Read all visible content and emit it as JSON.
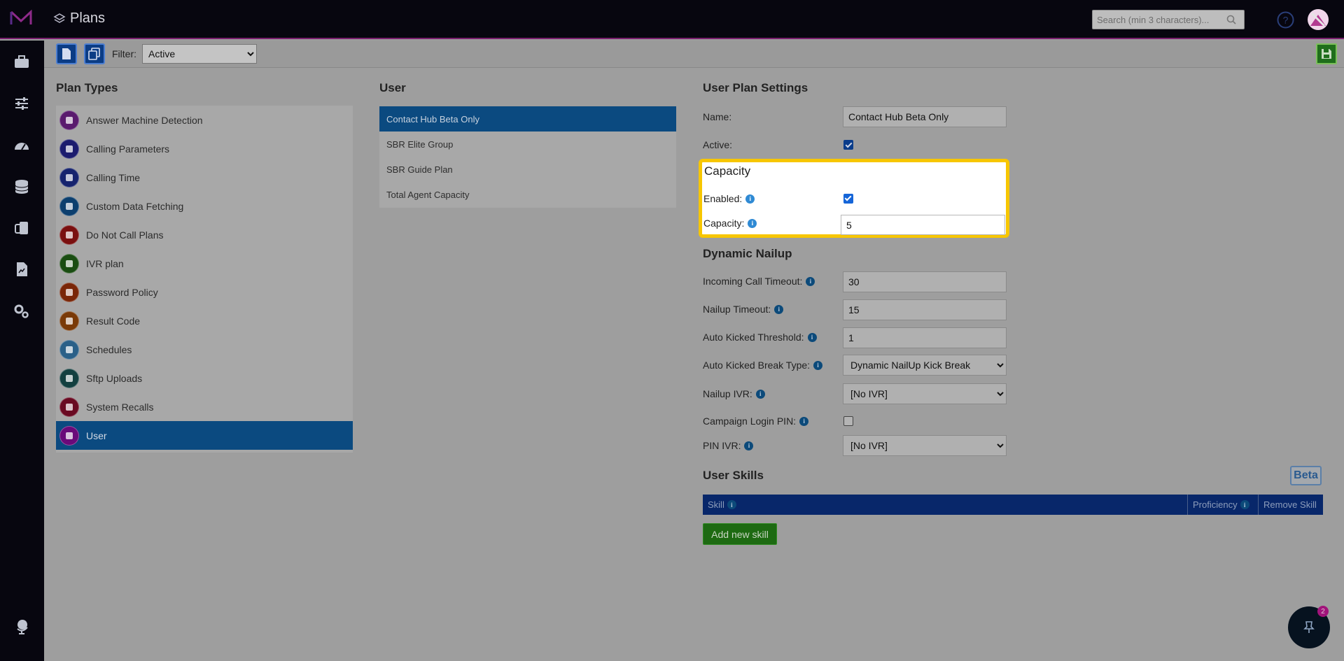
{
  "app": {
    "title": "Plans",
    "search_placeholder": "Search (min 3 characters)..."
  },
  "toolbar": {
    "filter_label": "Filter:",
    "filter_value": "Active",
    "filter_options": [
      "Active"
    ]
  },
  "plan_types": {
    "title": "Plan Types",
    "items": [
      {
        "label": "Answer Machine Detection",
        "color": "#5a1a6e"
      },
      {
        "label": "Calling Parameters",
        "color": "#1c1c6e"
      },
      {
        "label": "Calling Time",
        "color": "#16236e"
      },
      {
        "label": "Custom Data Fetching",
        "color": "#0c3f6e"
      },
      {
        "label": "Do Not Call Plans",
        "color": "#7a1010"
      },
      {
        "label": "IVR plan",
        "color": "#1a4d12"
      },
      {
        "label": "Password Policy",
        "color": "#7a2608"
      },
      {
        "label": "Result Code",
        "color": "#7a3a08"
      },
      {
        "label": "Schedules",
        "color": "#2a6088"
      },
      {
        "label": "Sftp Uploads",
        "color": "#134040"
      },
      {
        "label": "System Recalls",
        "color": "#6a0a22"
      },
      {
        "label": "User",
        "color": "#6a0a7a"
      }
    ],
    "active_index": 11
  },
  "user_list": {
    "title": "User",
    "items": [
      "Contact Hub Beta Only",
      "SBR Elite Group",
      "SBR Guide Plan",
      "Total Agent Capacity"
    ],
    "active_index": 0
  },
  "settings": {
    "title": "User Plan Settings",
    "name_label": "Name:",
    "name_value": "Contact Hub Beta Only",
    "active_label": "Active:",
    "active_checked": true
  },
  "capacity": {
    "title": "Capacity",
    "enabled_label": "Enabled:",
    "enabled_checked": true,
    "capacity_label": "Capacity:",
    "capacity_value": "5"
  },
  "nailup": {
    "title": "Dynamic Nailup",
    "incoming_label": "Incoming Call Timeout:",
    "incoming_value": "30",
    "nailup_timeout_label": "Nailup Timeout:",
    "nailup_timeout_value": "15",
    "kicked_threshold_label": "Auto Kicked Threshold:",
    "kicked_threshold_value": "1",
    "kicked_break_label": "Auto Kicked Break Type:",
    "kicked_break_value": "Dynamic NailUp Kick Break",
    "nailup_ivr_label": "Nailup IVR:",
    "nailup_ivr_value": "[No IVR]",
    "campaign_pin_label": "Campaign Login PIN:",
    "campaign_pin_checked": false,
    "pin_ivr_label": "PIN IVR:",
    "pin_ivr_value": "[No IVR]"
  },
  "skills": {
    "title": "User Skills",
    "beta_label": "Beta",
    "col_skill": "Skill",
    "col_proficiency": "Proficiency",
    "col_remove": "Remove Skill",
    "add_button": "Add new skill"
  },
  "notifications": {
    "count": "2"
  }
}
